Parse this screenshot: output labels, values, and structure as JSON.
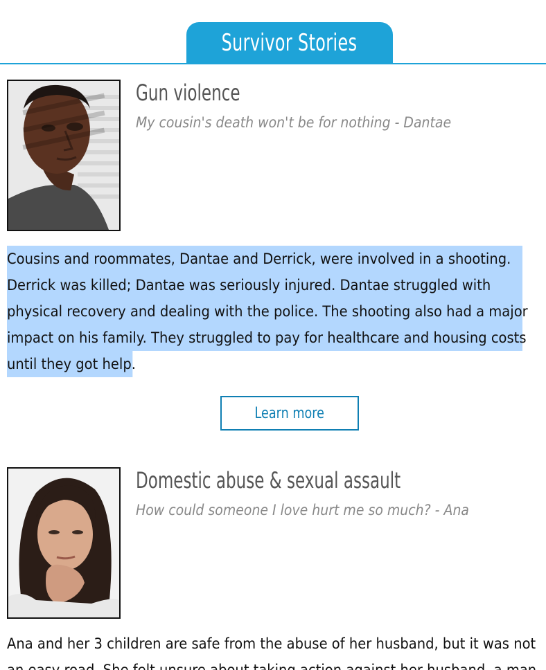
{
  "header": {
    "title": "Survivor Stories"
  },
  "stories": [
    {
      "heading": "Gun violence",
      "quote": "My cousin's death won't be for nothing - Dantae",
      "body_lines": [
        "Cousins and roommates, Dantae and Derrick, were involved in a shooting.",
        "Derrick was killed; Dantae was seriously injured. Dantae struggled with",
        "physical recovery and dealing with the police. The shooting also had a major",
        "impact on his family. They struggled to pay for healthcare and housing costs",
        "until they got help."
      ],
      "button_label": "Learn more",
      "photo_icon": "man-portrait"
    },
    {
      "heading": "Domestic abuse & sexual assault",
      "quote": "How could someone I love hurt me so much? - Ana",
      "body_lines": [
        "Ana and her 3 children are safe from the abuse of her husband, but it was not",
        "an easy road. She felt unsure about taking action against her husband, a man"
      ],
      "photo_icon": "woman-portrait"
    }
  ],
  "colors": {
    "accent": "#1ea3d8",
    "button": "#0f7fb3",
    "selection": "#b3d7fe"
  }
}
